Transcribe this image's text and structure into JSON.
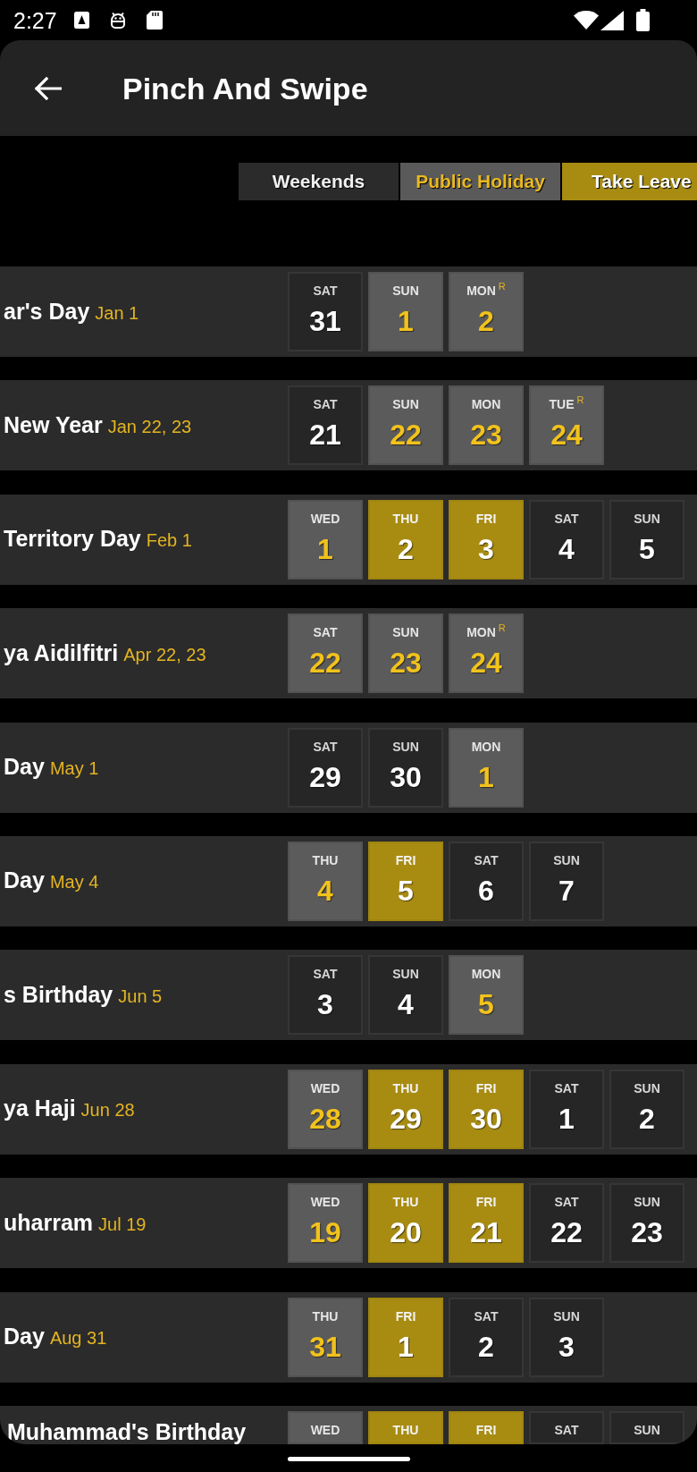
{
  "status_bar": {
    "time": "2:27"
  },
  "app_bar": {
    "title": "Pinch And Swipe"
  },
  "legend": [
    {
      "label": "Weekends",
      "kind": "weekend"
    },
    {
      "label": "Public Holiday",
      "kind": "holiday"
    },
    {
      "label": "Take Leave",
      "kind": "leave"
    }
  ],
  "rows": [
    {
      "name": "ar's Day",
      "date": "Jan 1",
      "days": [
        {
          "day": "SAT",
          "number": "31",
          "kind": "weekend"
        },
        {
          "day": "SUN",
          "number": "1",
          "kind": "holiday"
        },
        {
          "day": "MON",
          "number": "2",
          "kind": "holiday",
          "note": "R"
        }
      ]
    },
    {
      "name": "New Year",
      "date": "Jan 22, 23",
      "days": [
        {
          "day": "SAT",
          "number": "21",
          "kind": "weekend"
        },
        {
          "day": "SUN",
          "number": "22",
          "kind": "holiday"
        },
        {
          "day": "MON",
          "number": "23",
          "kind": "holiday"
        },
        {
          "day": "TUE",
          "number": "24",
          "kind": "holiday",
          "note": "R"
        }
      ]
    },
    {
      "name": "Territory Day",
      "date": "Feb 1",
      "days": [
        {
          "day": "WED",
          "number": "1",
          "kind": "holiday"
        },
        {
          "day": "THU",
          "number": "2",
          "kind": "leave"
        },
        {
          "day": "FRI",
          "number": "3",
          "kind": "leave"
        },
        {
          "day": "SAT",
          "number": "4",
          "kind": "weekend"
        },
        {
          "day": "SUN",
          "number": "5",
          "kind": "weekend"
        }
      ]
    },
    {
      "name": "ya Aidilfitri",
      "date": "Apr 22, 23",
      "days": [
        {
          "day": "SAT",
          "number": "22",
          "kind": "holiday"
        },
        {
          "day": "SUN",
          "number": "23",
          "kind": "holiday"
        },
        {
          "day": "MON",
          "number": "24",
          "kind": "holiday",
          "note": "R"
        }
      ]
    },
    {
      "name": "Day",
      "date": "May 1",
      "days": [
        {
          "day": "SAT",
          "number": "29",
          "kind": "weekend"
        },
        {
          "day": "SUN",
          "number": "30",
          "kind": "weekend"
        },
        {
          "day": "MON",
          "number": "1",
          "kind": "holiday"
        }
      ]
    },
    {
      "name": "Day",
      "date": "May 4",
      "days": [
        {
          "day": "THU",
          "number": "4",
          "kind": "holiday"
        },
        {
          "day": "FRI",
          "number": "5",
          "kind": "leave"
        },
        {
          "day": "SAT",
          "number": "6",
          "kind": "weekend"
        },
        {
          "day": "SUN",
          "number": "7",
          "kind": "weekend"
        }
      ]
    },
    {
      "name": "s Birthday",
      "date": "Jun 5",
      "days": [
        {
          "day": "SAT",
          "number": "3",
          "kind": "weekend"
        },
        {
          "day": "SUN",
          "number": "4",
          "kind": "weekend"
        },
        {
          "day": "MON",
          "number": "5",
          "kind": "holiday"
        }
      ]
    },
    {
      "name": "ya Haji",
      "date": "Jun 28",
      "days": [
        {
          "day": "WED",
          "number": "28",
          "kind": "holiday"
        },
        {
          "day": "THU",
          "number": "29",
          "kind": "leave"
        },
        {
          "day": "FRI",
          "number": "30",
          "kind": "leave"
        },
        {
          "day": "SAT",
          "number": "1",
          "kind": "weekend"
        },
        {
          "day": "SUN",
          "number": "2",
          "kind": "weekend"
        }
      ]
    },
    {
      "name": "uharram",
      "date": "Jul 19",
      "days": [
        {
          "day": "WED",
          "number": "19",
          "kind": "holiday"
        },
        {
          "day": "THU",
          "number": "20",
          "kind": "leave"
        },
        {
          "day": "FRI",
          "number": "21",
          "kind": "leave"
        },
        {
          "day": "SAT",
          "number": "22",
          "kind": "weekend"
        },
        {
          "day": "SUN",
          "number": "23",
          "kind": "weekend"
        }
      ]
    },
    {
      "name": "Day",
      "date": "Aug 31",
      "days": [
        {
          "day": "THU",
          "number": "31",
          "kind": "holiday"
        },
        {
          "day": "FRI",
          "number": "1",
          "kind": "leave"
        },
        {
          "day": "SAT",
          "number": "2",
          "kind": "weekend"
        },
        {
          "day": "SUN",
          "number": "3",
          "kind": "weekend"
        }
      ]
    },
    {
      "name": "Muhammad's Birthday",
      "days": [
        {
          "day": "WED",
          "kind": "holiday"
        },
        {
          "day": "THU",
          "kind": "leave"
        },
        {
          "day": "FRI",
          "kind": "leave"
        },
        {
          "day": "SAT",
          "kind": "weekend"
        },
        {
          "day": "SUN",
          "kind": "weekend"
        }
      ]
    }
  ]
}
